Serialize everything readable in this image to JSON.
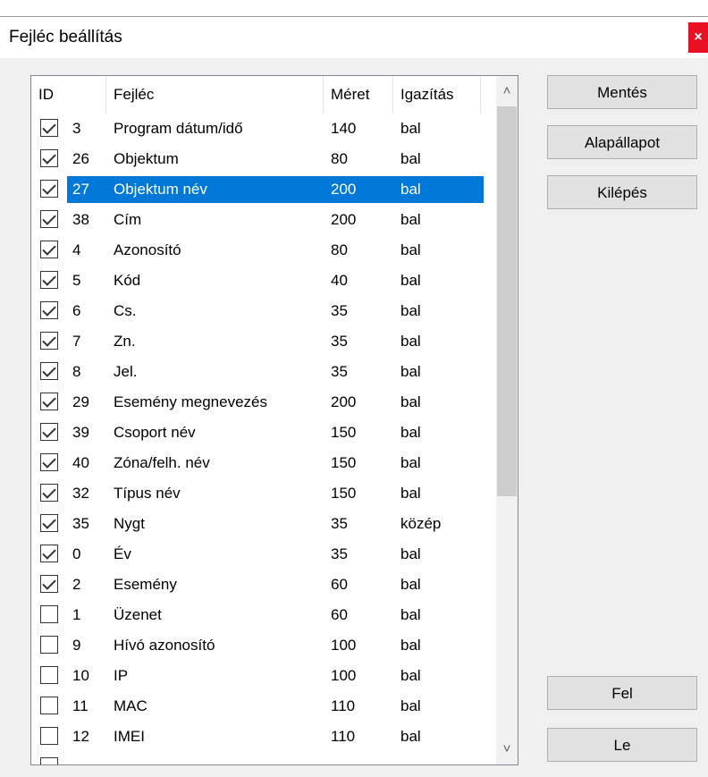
{
  "window": {
    "title": "Fejléc beállítás",
    "close_label": "×"
  },
  "table": {
    "columns": [
      "ID",
      "Fejléc",
      "Méret",
      "Igazítás"
    ],
    "selected_row": 2,
    "rows": [
      {
        "checked": true,
        "id": "3",
        "name": "Program dátum/idő",
        "size": "140",
        "align": "bal"
      },
      {
        "checked": true,
        "id": "26",
        "name": "Objektum",
        "size": "80",
        "align": "bal"
      },
      {
        "checked": true,
        "id": "27",
        "name": "Objektum név",
        "size": "200",
        "align": "bal"
      },
      {
        "checked": true,
        "id": "38",
        "name": "Cím",
        "size": "200",
        "align": "bal"
      },
      {
        "checked": true,
        "id": "4",
        "name": "Azonosító",
        "size": "80",
        "align": "bal"
      },
      {
        "checked": true,
        "id": "5",
        "name": "Kód",
        "size": "40",
        "align": "bal"
      },
      {
        "checked": true,
        "id": "6",
        "name": "Cs.",
        "size": "35",
        "align": "bal"
      },
      {
        "checked": true,
        "id": "7",
        "name": "Zn.",
        "size": "35",
        "align": "bal"
      },
      {
        "checked": true,
        "id": "8",
        "name": "Jel.",
        "size": "35",
        "align": "bal"
      },
      {
        "checked": true,
        "id": "29",
        "name": "Esemény megnevezés",
        "size": "200",
        "align": "bal"
      },
      {
        "checked": true,
        "id": "39",
        "name": "Csoport név",
        "size": "150",
        "align": "bal"
      },
      {
        "checked": true,
        "id": "40",
        "name": "Zóna/felh. név",
        "size": "150",
        "align": "bal"
      },
      {
        "checked": true,
        "id": "32",
        "name": "Típus név",
        "size": "150",
        "align": "bal"
      },
      {
        "checked": true,
        "id": "35",
        "name": "Nygt",
        "size": "35",
        "align": "közép"
      },
      {
        "checked": true,
        "id": "0",
        "name": "Év",
        "size": "35",
        "align": "bal"
      },
      {
        "checked": true,
        "id": "2",
        "name": "Esemény",
        "size": "60",
        "align": "bal"
      },
      {
        "checked": false,
        "id": "1",
        "name": "Üzenet",
        "size": "60",
        "align": "bal"
      },
      {
        "checked": false,
        "id": "9",
        "name": "Hívó azonosító",
        "size": "100",
        "align": "bal"
      },
      {
        "checked": false,
        "id": "10",
        "name": "IP",
        "size": "100",
        "align": "bal"
      },
      {
        "checked": false,
        "id": "11",
        "name": "MAC",
        "size": "110",
        "align": "bal"
      },
      {
        "checked": false,
        "id": "12",
        "name": "IMEI",
        "size": "110",
        "align": "bal"
      },
      {
        "checked": false,
        "id": "",
        "name": "",
        "size": "",
        "align": ""
      }
    ]
  },
  "scrollbar": {
    "up_icon": "chevron-up-icon",
    "down_icon": "chevron-down-icon"
  },
  "buttons": {
    "save": "Mentés",
    "reset": "Alapállapot",
    "exit": "Kilépés",
    "up": "Fel",
    "down": "Le"
  },
  "colors": {
    "selection": "#0078d7",
    "close": "#e81123",
    "button_bg": "#e1e1e1"
  }
}
